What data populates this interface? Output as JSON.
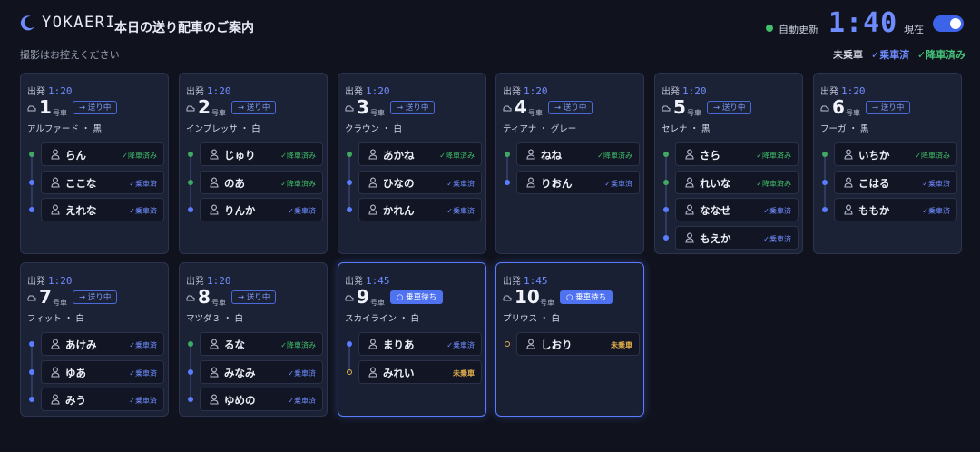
{
  "header": {
    "logo": "YOKAERI",
    "title": "本日の送り配車のご案内",
    "note": "撮影はお控えください",
    "auto_update": "自動更新",
    "clock": "1:40",
    "now": "現在"
  },
  "legend": {
    "not_boarded": "未乗車",
    "boarded": "✓乗車済",
    "alighted": "✓降車済み"
  },
  "unit_label": "号車",
  "depart_label": "出発",
  "cars": [
    {
      "time": "1:20",
      "number": "1",
      "status": "→ 送り中",
      "model": "アルファード ・ 黒",
      "passengers": [
        {
          "name": "らん",
          "status": "✓降車済み",
          "state": "alight"
        },
        {
          "name": "ここな",
          "status": "✓乗車済",
          "state": "board"
        },
        {
          "name": "えれな",
          "status": "✓乗車済",
          "state": "board"
        }
      ]
    },
    {
      "time": "1:20",
      "number": "2",
      "status": "→ 送り中",
      "model": "インプレッサ ・ 白",
      "passengers": [
        {
          "name": "じゅり",
          "status": "✓降車済み",
          "state": "alight"
        },
        {
          "name": "のあ",
          "status": "✓降車済み",
          "state": "alight"
        },
        {
          "name": "りんか",
          "status": "✓乗車済",
          "state": "board"
        }
      ]
    },
    {
      "time": "1:20",
      "number": "3",
      "status": "→ 送り中",
      "model": "クラウン ・ 白",
      "passengers": [
        {
          "name": "あかね",
          "status": "✓降車済み",
          "state": "alight"
        },
        {
          "name": "ひなの",
          "status": "✓乗車済",
          "state": "board"
        },
        {
          "name": "かれん",
          "status": "✓乗車済",
          "state": "board"
        }
      ]
    },
    {
      "time": "1:20",
      "number": "4",
      "status": "→ 送り中",
      "model": "ティアナ ・ グレー",
      "passengers": [
        {
          "name": "ねね",
          "status": "✓降車済み",
          "state": "alight"
        },
        {
          "name": "りおん",
          "status": "✓乗車済",
          "state": "board"
        }
      ]
    },
    {
      "time": "1:20",
      "number": "5",
      "status": "→ 送り中",
      "model": "セレナ ・ 黒",
      "passengers": [
        {
          "name": "さら",
          "status": "✓降車済み",
          "state": "alight"
        },
        {
          "name": "れいな",
          "status": "✓降車済み",
          "state": "alight"
        },
        {
          "name": "ななせ",
          "status": "✓乗車済",
          "state": "board"
        },
        {
          "name": "もえか",
          "status": "✓乗車済",
          "state": "board"
        }
      ]
    },
    {
      "time": "1:20",
      "number": "6",
      "status": "→ 送り中",
      "model": "フーガ ・ 黒",
      "passengers": [
        {
          "name": "いちか",
          "status": "✓降車済み",
          "state": "alight"
        },
        {
          "name": "こはる",
          "status": "✓乗車済",
          "state": "board"
        },
        {
          "name": "ももか",
          "status": "✓乗車済",
          "state": "board"
        }
      ]
    },
    {
      "time": "1:20",
      "number": "7",
      "status": "→ 送り中",
      "model": "フィット ・ 白",
      "passengers": [
        {
          "name": "あけみ",
          "status": "✓乗車済",
          "state": "board"
        },
        {
          "name": "ゆあ",
          "status": "✓乗車済",
          "state": "board"
        },
        {
          "name": "みう",
          "status": "✓乗車済",
          "state": "board"
        }
      ]
    },
    {
      "time": "1:20",
      "number": "8",
      "status": "→ 送り中",
      "model": "マツダ３ ・ 白",
      "passengers": [
        {
          "name": "るな",
          "status": "✓降車済み",
          "state": "alight"
        },
        {
          "name": "みなみ",
          "status": "✓乗車済",
          "state": "board"
        },
        {
          "name": "ゆめの",
          "status": "✓乗車済",
          "state": "board"
        }
      ]
    },
    {
      "time": "1:45",
      "number": "9",
      "status": "○ 乗車待ち",
      "model": "スカイライン ・ 白",
      "active": true,
      "passengers": [
        {
          "name": "まりあ",
          "status": "✓乗車済",
          "state": "board"
        },
        {
          "name": "みれい",
          "status": "未乗車",
          "state": "none"
        }
      ]
    },
    {
      "time": "1:45",
      "number": "10",
      "status": "○ 乗車待ち",
      "model": "プリウス ・ 白",
      "active": true,
      "passengers": [
        {
          "name": "しおり",
          "status": "未乗車",
          "state": "none"
        }
      ]
    }
  ]
}
